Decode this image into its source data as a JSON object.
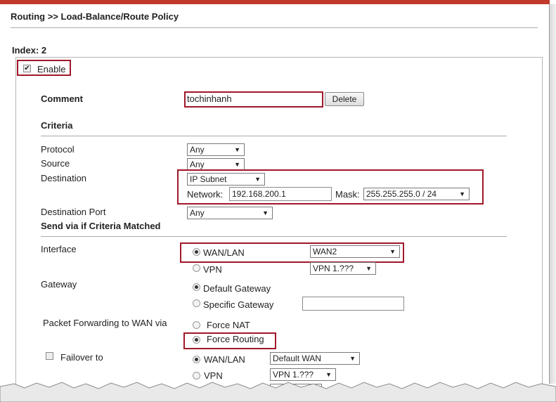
{
  "header": {
    "title": "Routing >> Load-Balance/Route Policy"
  },
  "index": {
    "label": "Index: 2"
  },
  "enable": {
    "label": "Enable",
    "checked": true
  },
  "comment": {
    "label": "Comment",
    "value": "tochinhanh",
    "delete_label": "Delete"
  },
  "criteria": {
    "heading": "Criteria",
    "protocol": {
      "label": "Protocol",
      "value": "Any"
    },
    "source": {
      "label": "Source",
      "value": "Any"
    },
    "destination": {
      "label": "Destination",
      "type_value": "IP Subnet",
      "network_label": "Network:",
      "network_value": "192.168.200.1",
      "mask_label": "Mask:",
      "mask_value": "255.255.255.0 / 24"
    },
    "dest_port": {
      "label": "Destination Port",
      "value": "Any"
    }
  },
  "send": {
    "heading": "Send via if Criteria Matched",
    "interface": {
      "label": "Interface",
      "wanlan_label": "WAN/LAN",
      "wanlan_value": "WAN2",
      "vpn_label": "VPN",
      "vpn_value": "VPN 1.???",
      "selected": "WAN/LAN"
    },
    "gateway": {
      "label": "Gateway",
      "default_label": "Default Gateway",
      "specific_label": "Specific Gateway",
      "specific_value": "",
      "selected": "Default Gateway"
    },
    "forwarding": {
      "label": "Packet Forwarding to WAN via",
      "force_nat_label": "Force NAT",
      "force_routing_label": "Force Routing",
      "selected": "Force Routing"
    },
    "failover": {
      "label": "Failover to",
      "checked": false,
      "wanlan_label": "WAN/LAN",
      "wanlan_value": "Default WAN",
      "vpn_label": "VPN",
      "vpn_value": "VPN 1.???",
      "selected": "WAN/LAN"
    }
  },
  "colors": {
    "accent": "#c0392b",
    "highlight_box": "#a0182a"
  }
}
